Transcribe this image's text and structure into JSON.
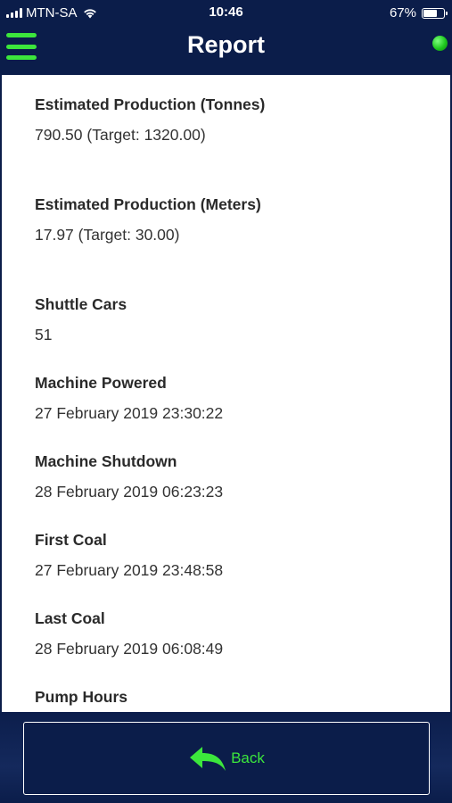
{
  "status_bar": {
    "carrier": "MTN-SA",
    "time": "10:46",
    "battery": "67%"
  },
  "header": {
    "title": "Report",
    "menu_icon": "hamburger-menu-icon",
    "status_indicator_color": "#1ec81e"
  },
  "colors": {
    "background": "#0b1d4a",
    "accent": "#3ce63c",
    "panel": "#ffffff"
  },
  "report": {
    "fields": [
      {
        "label": "Estimated Production (Tonnes)",
        "value": "790.50 (Target: 1320.00)"
      },
      {
        "label": "Estimated Production (Meters)",
        "value": "17.97 (Target: 30.00)"
      },
      {
        "label": "Shuttle Cars",
        "value": "51"
      },
      {
        "label": "Machine Powered",
        "value": "27 February 2019 23:30:22"
      },
      {
        "label": "Machine Shutdown",
        "value": "28 February 2019 06:23:23"
      },
      {
        "label": "First Coal",
        "value": "27 February 2019 23:48:58"
      },
      {
        "label": "Last Coal",
        "value": "28 February 2019 06:08:49"
      },
      {
        "label": "Pump Hours",
        "value": ""
      }
    ]
  },
  "footer": {
    "back_label": "Back",
    "back_icon": "back-arrow-icon"
  }
}
